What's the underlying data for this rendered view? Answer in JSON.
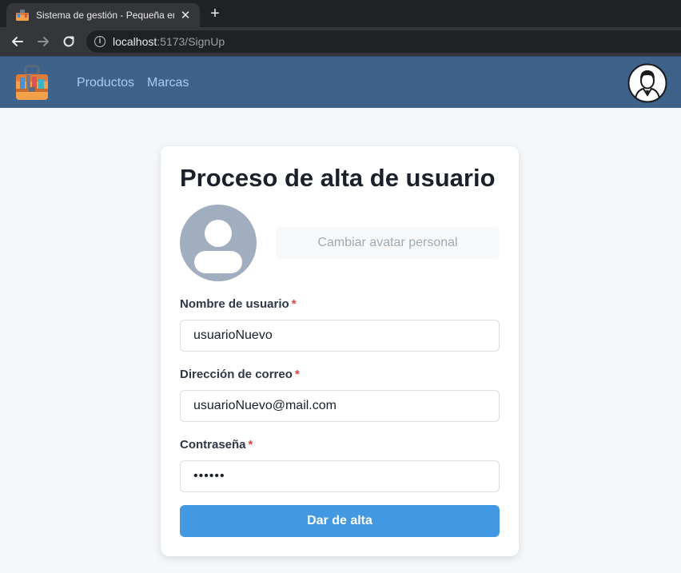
{
  "browser": {
    "tab_title": "Sistema de gestión - Pequeña em",
    "tab_close": "✕",
    "new_tab": "+",
    "url_host": "localhost",
    "url_path": ":5173/SignUp",
    "info_glyph": "i"
  },
  "nav": {
    "links": [
      {
        "label": "Productos"
      },
      {
        "label": "Marcas"
      }
    ],
    "logo_icon": "toolbox-icon",
    "profile_icon": "user-profile-icon",
    "bar_color": "#3e6289",
    "link_color": "#a7cdf2"
  },
  "form": {
    "title": "Proceso de alta de usuario",
    "avatar_button": "Cambiar avatar personal",
    "required_marker": "*",
    "fields": [
      {
        "label": "Nombre de usuario",
        "value": "usuarioNuevo",
        "type": "text"
      },
      {
        "label": "Dirección de correo",
        "value": "usuarioNuevo@mail.com",
        "type": "email"
      },
      {
        "label": "Contraseña",
        "value": "••••••",
        "type": "password"
      }
    ],
    "submit": "Dar de alta",
    "accent_color": "#4299e1",
    "required_color": "#e53e3e"
  }
}
